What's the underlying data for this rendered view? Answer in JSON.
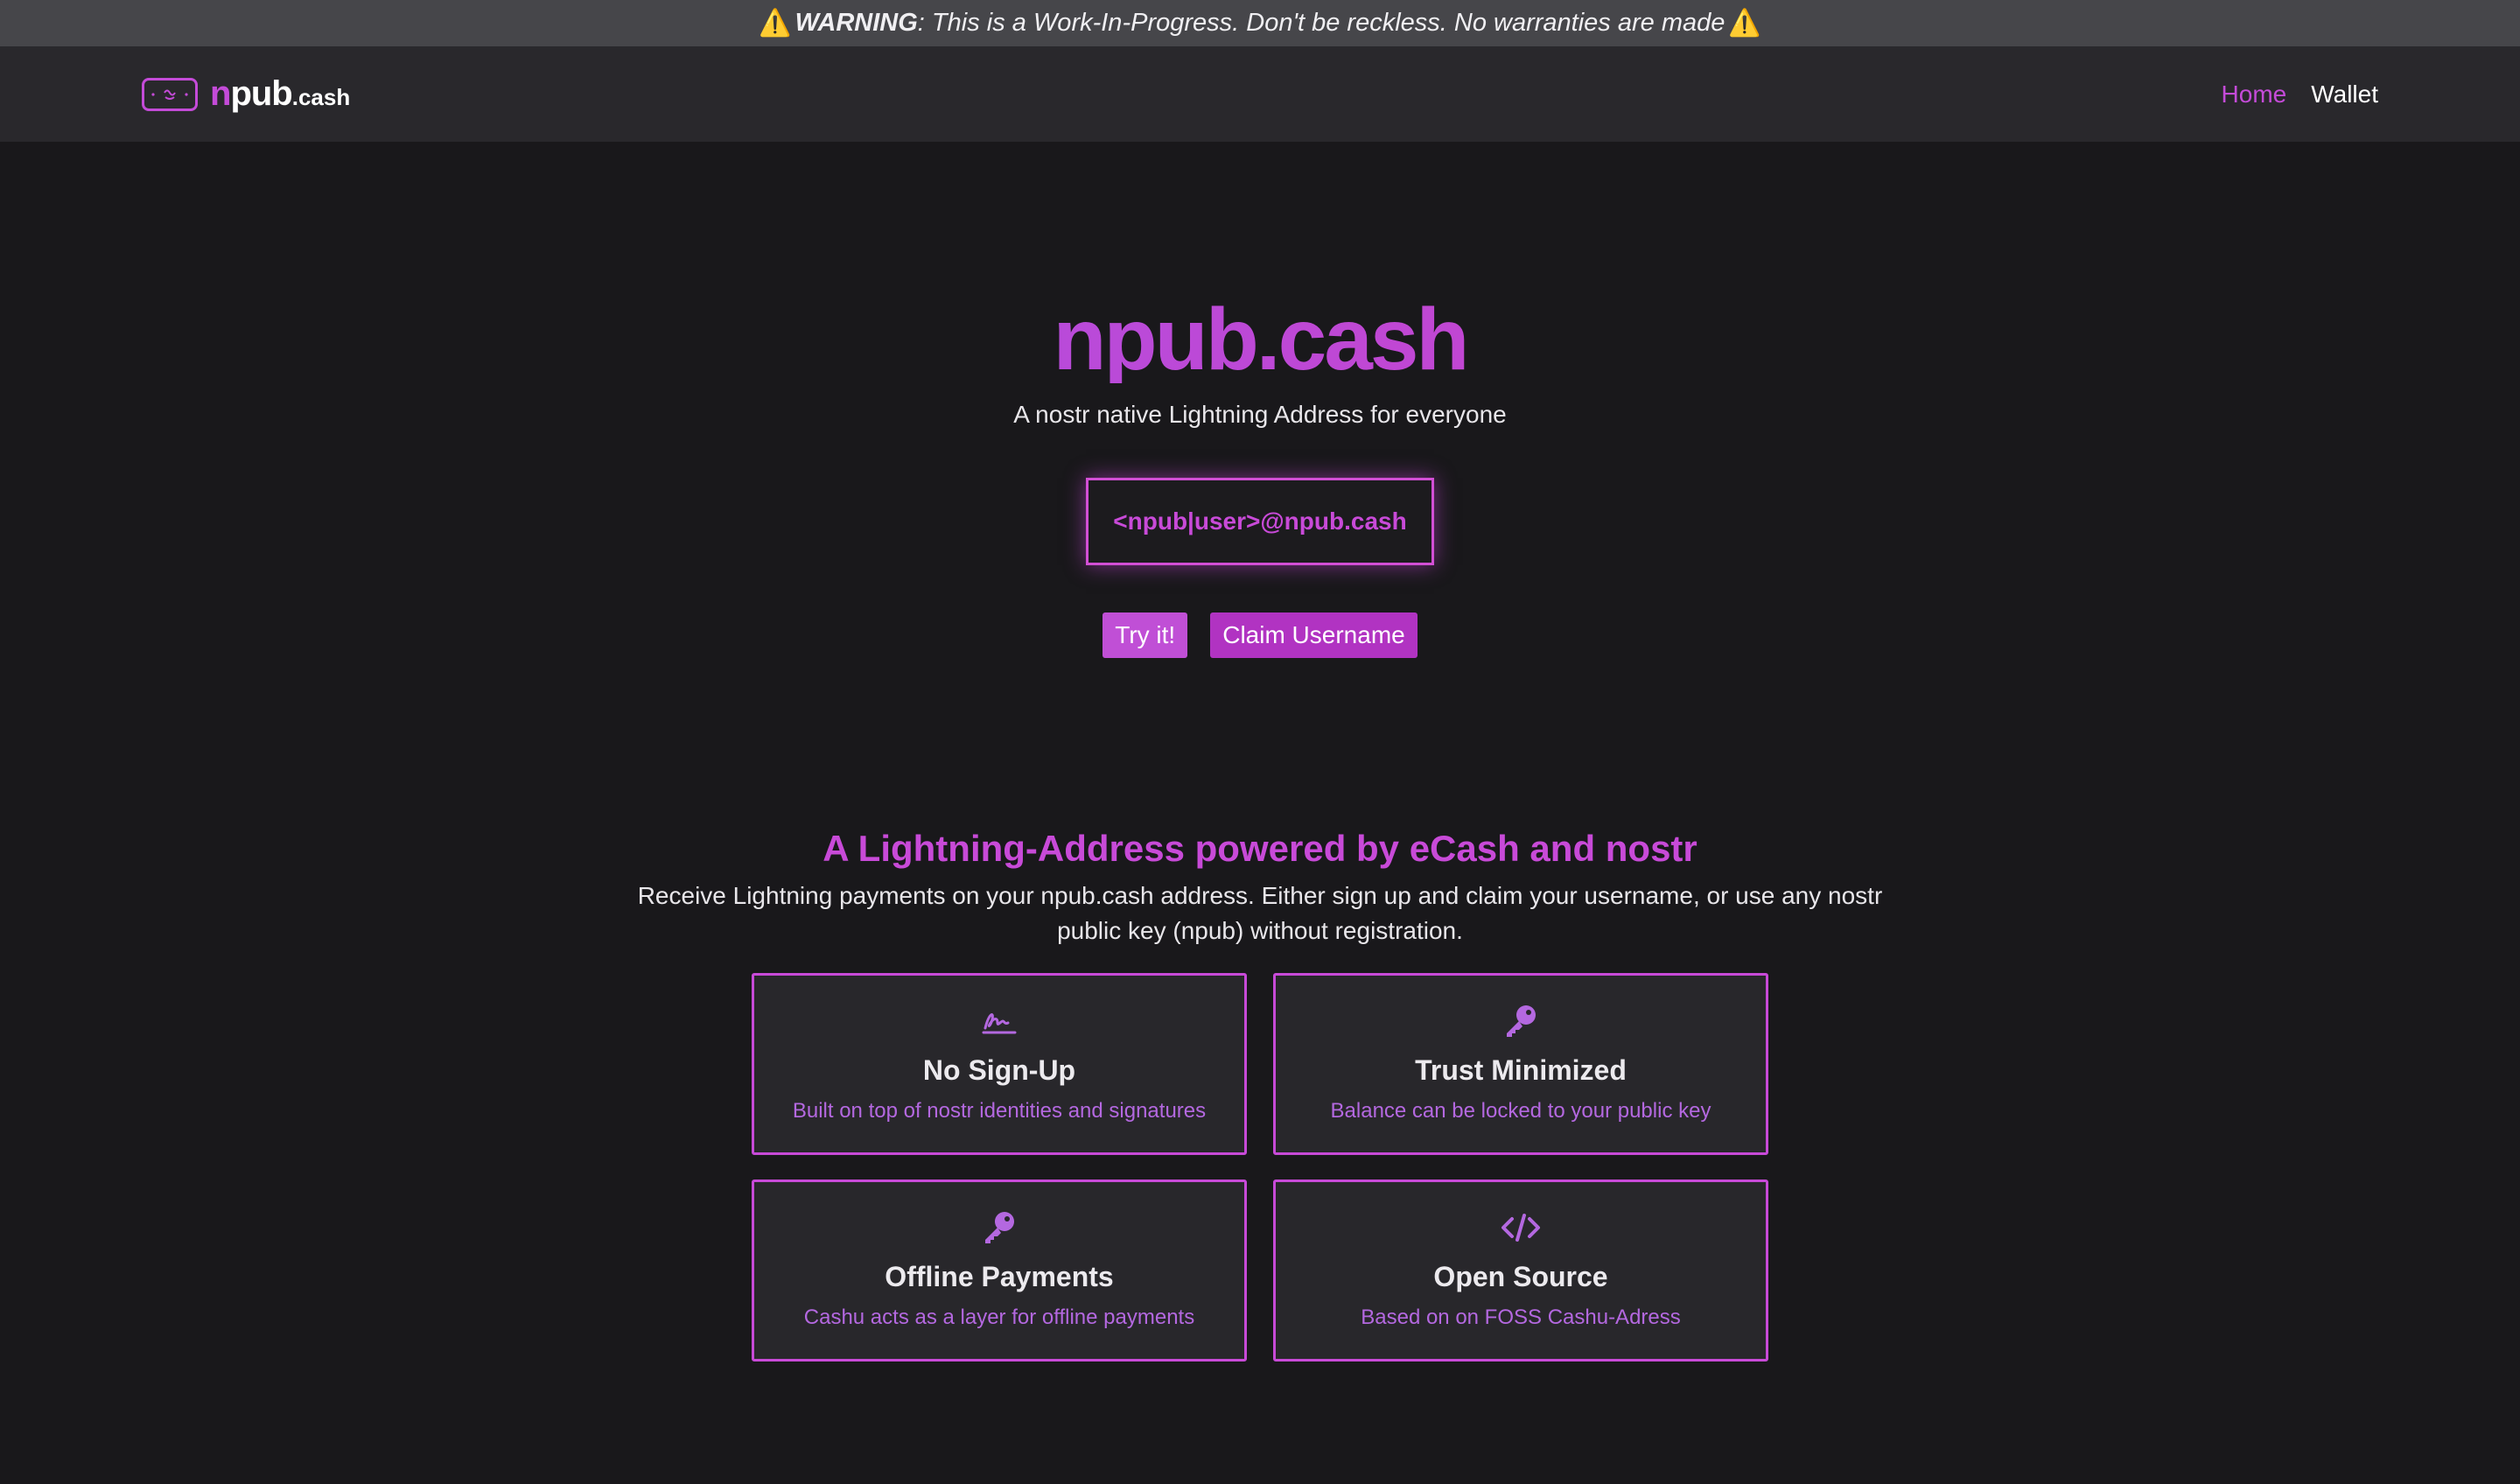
{
  "banner": {
    "label": "WARNING",
    "message": ": This is a Work-In-Progress. Don't be reckless. No warranties are made",
    "icon": "warning-icon"
  },
  "nav": {
    "brand_n": "n",
    "brand_pub": "pub",
    "brand_tld": ".cash",
    "home": "Home",
    "wallet": "Wallet"
  },
  "hero": {
    "title": "npub.cash",
    "subtitle": "A nostr native Lightning Address for everyone",
    "address": "<npub|user>@npub.cash",
    "try_button": "Try it!",
    "claim_button": "Claim Username"
  },
  "features": {
    "title": "A Lightning-Address powered by eCash and nostr",
    "description": "Receive Lightning payments on your npub.cash address. Either sign up and claim your username, or use any nostr public key (npub) without registration.",
    "cards": [
      {
        "icon": "signature-icon",
        "title": "No Sign-Up",
        "text": "Built on top of nostr identities and signatures"
      },
      {
        "icon": "key-icon",
        "title": "Trust Minimized",
        "text": "Balance can be locked to your public key"
      },
      {
        "icon": "key-icon",
        "title": "Offline Payments",
        "text": "Cashu acts as a layer for offline payments"
      },
      {
        "icon": "code-icon",
        "title": "Open Source",
        "text": "Based on on FOSS Cashu-Adress"
      }
    ]
  },
  "colors": {
    "accent": "#c84ad8",
    "background": "#19181b",
    "navbar": "#29282c",
    "banner": "#46464a",
    "card": "#28272b"
  }
}
